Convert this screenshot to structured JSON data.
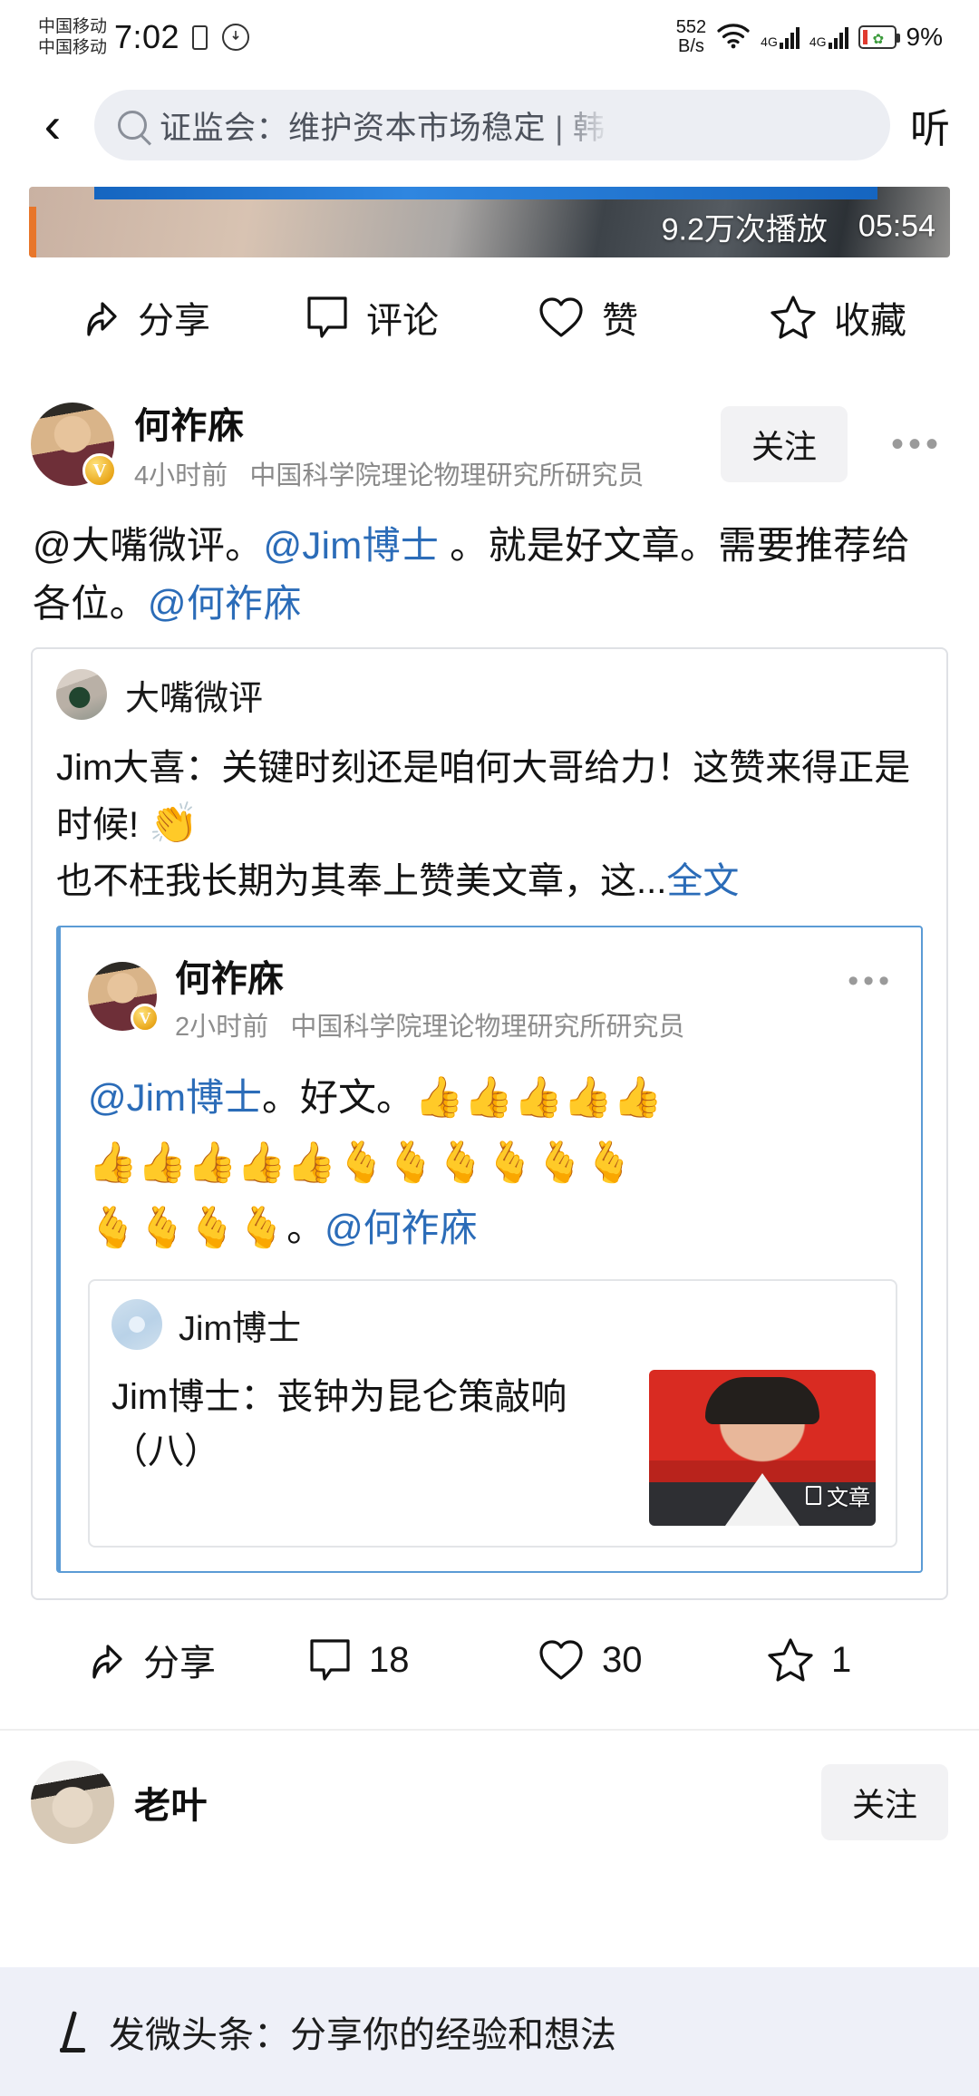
{
  "status_bar": {
    "carrier_line1": "中国移动",
    "carrier_line2": "中国移动",
    "time": "7:02",
    "net_speed_value": "552",
    "net_speed_unit": "B/s",
    "network_label_1": "4G",
    "network_label_2": "4G",
    "battery_percent": "9%"
  },
  "top_nav": {
    "back_label": "‹",
    "search_value": "证监会：维护资本市场稳定 | 韩 ",
    "listen_label": "听"
  },
  "video": {
    "play_count": "9.2万次播放",
    "duration": "05:54"
  },
  "action_bar_top": {
    "share": "分享",
    "comment": "评论",
    "like": "赞",
    "favorite": "收藏"
  },
  "post": {
    "author_name": "何祚庥",
    "time": "4小时前",
    "title": "中国科学院理论物理研究所研究员",
    "follow_label": "关注",
    "more_label": "•••",
    "text_part1": "@大嘴微评。",
    "text_mention1": "@Jim博士",
    "text_part2": " 。就是好文章。需要推荐给各位。",
    "text_mention2": "@何祚庥"
  },
  "quote_card": {
    "author_name": "大嘴微评",
    "line1": "Jim大喜：关键时刻还是咱何大哥给力！这赞来得正是时候!",
    "emoji_clap": "👏",
    "line2": "也不枉我长期为其奉上赞美文章，这...",
    "more_label": "全文"
  },
  "inner_card": {
    "author_name": "何祚庥",
    "time": "2小时前",
    "title": "中国科学院理论物理研究所研究员",
    "more_label": "•••",
    "text_mention": "@Jim博士",
    "text_after": "。好文。",
    "thumbs_row1": "👍👍👍👍👍",
    "thumbs_row2": "👍👍👍👍👍",
    "hearts_row2": "🫰🫰🫰🫰🫰🫰",
    "hearts_row3": "🫰🫰🫰🫰",
    "period": "。",
    "mention_end": "@何祚庥"
  },
  "article_card": {
    "author_name": "Jim博士",
    "title": "Jim博士：丧钟为昆仑策敲响（八）",
    "thumb_tag": "文章"
  },
  "action_bar_bottom": {
    "share": "分享",
    "comment_count": "18",
    "like_count": "30",
    "favorite_count": "1"
  },
  "next_post": {
    "author_name": "老叶",
    "follow_label": "关注"
  },
  "composer": {
    "placeholder": "发微头条：分享你的经验和想法"
  },
  "colors": {
    "mention_blue": "#2b6cb8",
    "inner_border_blue": "#5b9bd5",
    "follow_bg": "#f2f2f4",
    "composer_bg": "#eef0f8",
    "battery_red": "#e03a2f"
  }
}
